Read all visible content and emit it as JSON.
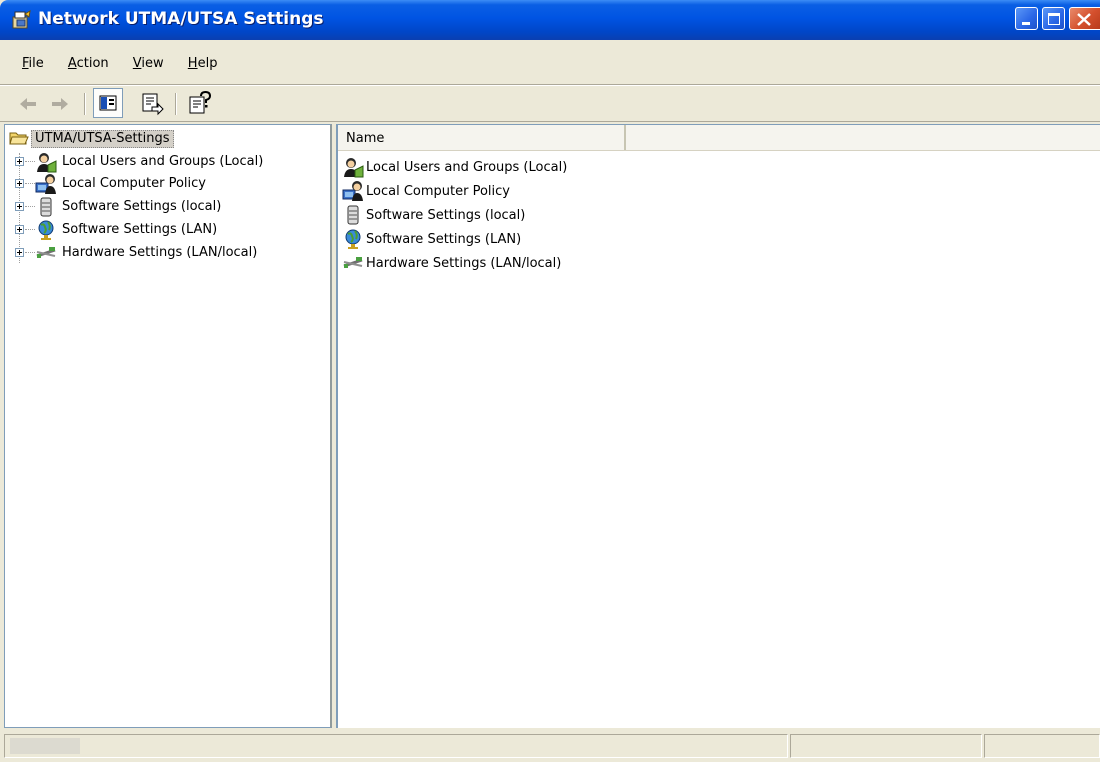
{
  "window": {
    "title": "Network UTMA/UTSA Settings",
    "icon": "snap-in-console-icon"
  },
  "menu": {
    "items": [
      {
        "underline": "F",
        "rest": "ile"
      },
      {
        "underline": "A",
        "rest": "ction"
      },
      {
        "underline": "V",
        "rest": "iew"
      },
      {
        "underline": "H",
        "rest": "elp"
      }
    ]
  },
  "toolbar": {
    "buttons": [
      "back-arrow-icon",
      "forward-arrow-icon",
      "show-hide-console-tree-icon",
      "export-list-icon",
      "help-icon"
    ]
  },
  "tree": {
    "root_label": "UTMA/UTSA-Settings",
    "items": [
      {
        "label": "Local Users and Groups (Local)",
        "icon": "users-groups-icon"
      },
      {
        "label": "Local Computer Policy",
        "icon": "computer-policy-icon"
      },
      {
        "label": "Software Settings (local)",
        "icon": "server-icon"
      },
      {
        "label": "Software Settings (LAN)",
        "icon": "globe-icon"
      },
      {
        "label": "Hardware Settings (LAN/local)",
        "icon": "network-cable-icon"
      }
    ]
  },
  "list": {
    "column_name": "Name",
    "items": [
      {
        "label": "Local Users and Groups (Local)",
        "icon": "users-groups-icon"
      },
      {
        "label": "Local Computer Policy",
        "icon": "computer-policy-icon"
      },
      {
        "label": "Software Settings (local)",
        "icon": "server-icon"
      },
      {
        "label": "Software Settings (LAN)",
        "icon": "globe-icon"
      },
      {
        "label": "Hardware Settings (LAN/local)",
        "icon": "network-cable-icon"
      }
    ]
  }
}
